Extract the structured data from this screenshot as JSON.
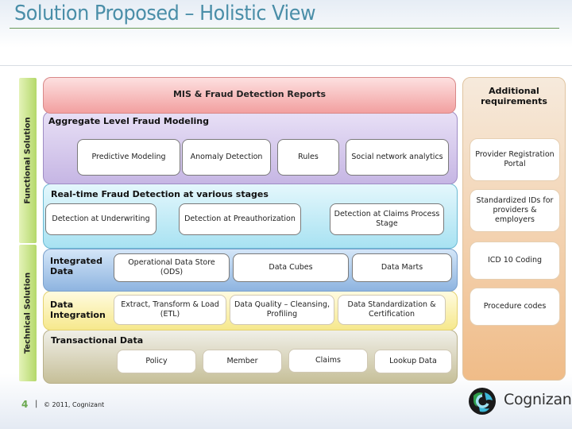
{
  "slide": {
    "title": "Solution Proposed – Holistic View",
    "page_number": "4",
    "footer_separator": "|",
    "copyright": "© 2011, Cognizant",
    "logo_text": "Cognizant"
  },
  "side_labels": {
    "functional": "Functional Solution",
    "technical": "Technical Solution"
  },
  "functional": {
    "reports": {
      "title": "MIS & Fraud Detection Reports"
    },
    "aggregate": {
      "title": "Aggregate Level Fraud Modeling",
      "items": [
        "Predictive Modeling",
        "Anomaly Detection",
        "Rules",
        "Social network analytics"
      ]
    },
    "realtime": {
      "title": "Real-time Fraud Detection at various stages",
      "items": [
        "Detection at Underwriting",
        "Detection at Preauthorization",
        "Detection at Claims Process Stage"
      ]
    }
  },
  "technical": {
    "integrated_data": {
      "title": "Integrated Data",
      "items": [
        "Operational Data Store (ODS)",
        "Data Cubes",
        "Data Marts"
      ]
    },
    "data_integration": {
      "title": "Data Integration",
      "items": [
        "Extract, Transform & Load (ETL)",
        "Data Quality – Cleansing, Profiling",
        "Data Standardization & Certification"
      ]
    },
    "transactional": {
      "title": "Transactional Data",
      "items": [
        "Policy",
        "Member",
        "Claims",
        "Lookup Data"
      ]
    }
  },
  "additional": {
    "title": "Additional requirements",
    "items": [
      "Provider Registration Portal",
      "Standardized IDs for providers & employers",
      "ICD 10 Coding",
      "Procedure codes"
    ]
  },
  "colors": {
    "title": "#4a8ea8",
    "reports_band": "#f2a0a0",
    "aggregate_band": "#c6b6e4",
    "realtime_band": "#a8e2f2",
    "integrated_band": "#8eb4e0",
    "integration_band": "#f6e88c",
    "transactional_band": "#c6bf98",
    "additional_band": "#f0bc88",
    "side_tab": "#b4d86a",
    "page_number": "#6aa84f"
  }
}
